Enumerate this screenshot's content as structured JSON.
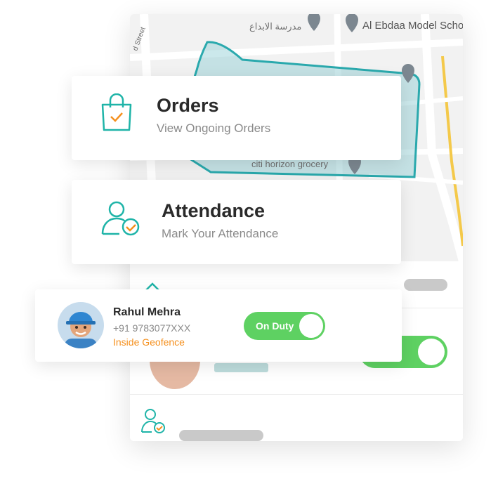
{
  "colors": {
    "accent": "#1fb4a8",
    "orange": "#f5901e",
    "green_toggle": "#5ed162"
  },
  "map": {
    "labels": [
      "مدرسة الابداع",
      "Al Ebdaa Model Scho",
      "d Street",
      "citi horizon grocery"
    ]
  },
  "orders": {
    "title": "Orders",
    "subtitle": "View Ongoing Orders",
    "icon": "shopping-bag-check-icon"
  },
  "attendance": {
    "title": "Attendance",
    "subtitle": "Mark Your Attendance",
    "icon": "user-check-icon"
  },
  "profile": {
    "name": "Rahul Mehra",
    "phone": "+91 9783077XXX",
    "status": "Inside Geofence",
    "duty_label": "On Duty",
    "duty_on": true
  }
}
